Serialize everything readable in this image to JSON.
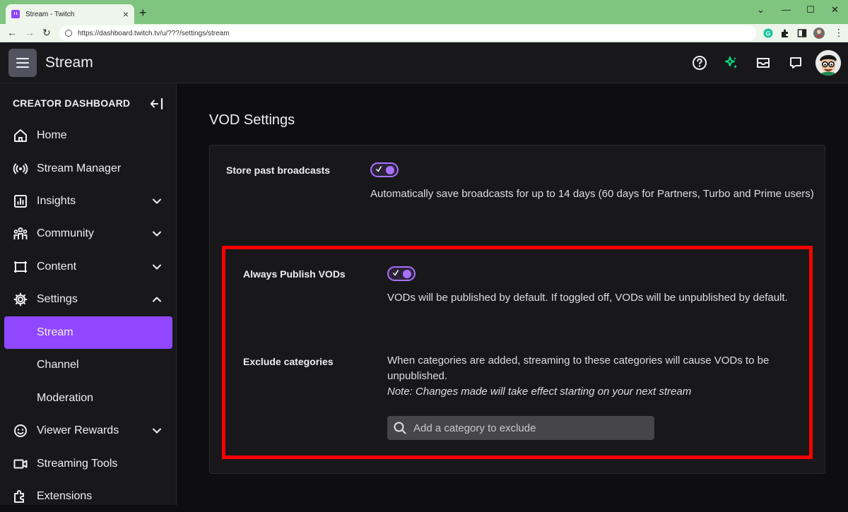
{
  "browser": {
    "tab_title": "Stream - Twitch",
    "tab_close": "×",
    "new_tab": "+",
    "url": "https://dashboard.twitch.tv/u/???/settings/stream",
    "back": "←",
    "forward": "→",
    "reload": "↻",
    "win_min": "—",
    "win_max": "☐",
    "win_close": "✕",
    "win_chevron": "⌄",
    "menu": "⋮"
  },
  "header": {
    "title": "Stream"
  },
  "sidebar": {
    "heading": "CREATOR DASHBOARD",
    "items": [
      {
        "label": "Home"
      },
      {
        "label": "Stream Manager"
      },
      {
        "label": "Insights"
      },
      {
        "label": "Community"
      },
      {
        "label": "Content"
      },
      {
        "label": "Settings"
      },
      {
        "label": "Stream"
      },
      {
        "label": "Channel"
      },
      {
        "label": "Moderation"
      },
      {
        "label": "Viewer Rewards"
      },
      {
        "label": "Streaming Tools"
      },
      {
        "label": "Extensions"
      }
    ]
  },
  "main": {
    "section_title": "VOD Settings",
    "store": {
      "label": "Store past broadcasts",
      "enabled": true,
      "description": "Automatically save broadcasts for up to 14 days (60 days for Partners, Turbo and Prime users)"
    },
    "publish": {
      "label": "Always Publish VODs",
      "enabled": true,
      "description": "VODs will be published by default. If toggled off, VODs will be unpublished by default."
    },
    "exclude": {
      "label": "Exclude categories",
      "description": "When categories are added, streaming to these categories will cause VODs to be unpublished.",
      "note": "Note: Changes made will take effect starting on your next stream",
      "placeholder": "Add a category to exclude"
    }
  },
  "colors": {
    "accent": "#9147ff",
    "highlight": "#ff0000",
    "background": "#0e0e10",
    "panel": "#18181b"
  }
}
